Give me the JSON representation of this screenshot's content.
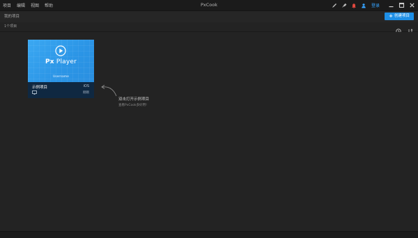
{
  "menu": [
    "项目",
    "编辑",
    "视图",
    "帮助"
  ],
  "app_title": "PxCook",
  "header": {
    "login_label": "登录",
    "icons": [
      "brush-icon",
      "color-picker-icon",
      "bell-icon",
      "user-icon"
    ],
    "window_controls": [
      "minimize-icon",
      "maximize-icon",
      "close-icon"
    ]
  },
  "toolbar": {
    "breadcrumb": "我的项目",
    "create_label": "创建项目",
    "project_count": "1个项目",
    "sort_icon": "clock-icon",
    "filter_icon": "filter-icon"
  },
  "project": {
    "brand_prefix": "Px",
    "brand_suffix": "Player",
    "thumb_subtitle": "Username",
    "name": "示例项目",
    "platform": "iOS",
    "time": "刚刚",
    "device_icon": "monitor-icon"
  },
  "hint": {
    "title": "双击打开示例项目",
    "subtitle": "查看PxCook多好用!"
  },
  "colors": {
    "accent": "#1e8fe6",
    "link": "#36a3ff",
    "background": "#232323",
    "card_thumb": "#2b95e6",
    "card_footer": "#0f2841"
  },
  "statusbar": {
    "icons": [
      "home-icon",
      "share-icon"
    ]
  }
}
